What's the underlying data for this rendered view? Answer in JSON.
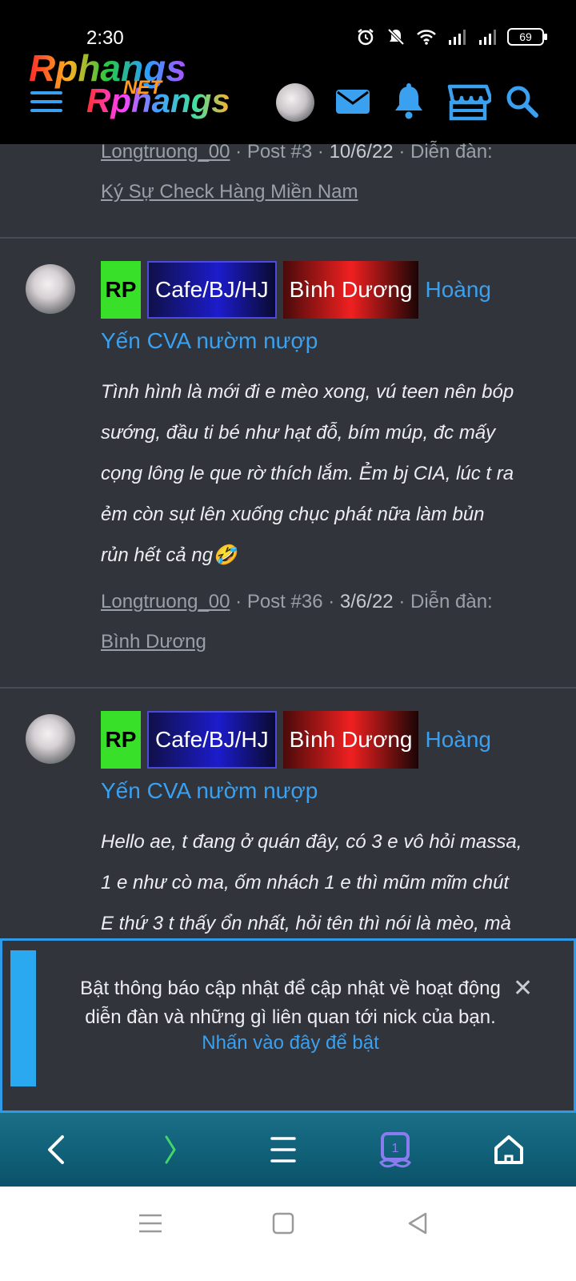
{
  "status_bar": {
    "time": "2:30",
    "battery": "69",
    "icons": [
      "alarm-icon",
      "mute-icon",
      "wifi-icon",
      "signal-icon",
      "signal-icon",
      "battery-icon"
    ]
  },
  "header": {
    "logo_top": "Rphangs",
    "logo_net": "NET",
    "logo_bottom": "Rphangs",
    "icons": [
      "menu-icon",
      "avatar",
      "mail-icon",
      "bell-icon",
      "store-icon",
      "search-icon"
    ],
    "accent": "#3aa0f0"
  },
  "posts": [
    {
      "author": "Longtruong_00",
      "post_no": "Post #3",
      "date": "10/6/22",
      "forum_label": "Diễn đàn:",
      "forum": "Ký Sự Check Hàng Miền Nam"
    },
    {
      "badges": [
        "RP",
        "Cafe/BJ/HJ",
        "Bình Dương"
      ],
      "title_part1": "Hoàng",
      "title_part2": "Yến CVA nườm nượp",
      "body_lines": [
        "Tình hình là mới đi e mèo xong, vú teen nên bóp",
        "sướng, đầu ti bé như hạt đỗ, bím múp, đc mấy",
        "cọng lông le que rờ thích lắm. Ẻm bj CIA, lúc t ra",
        "ẻm còn sụt lên xuống chục phát nữa làm bủn",
        "rủn hết cả ng🤣"
      ],
      "author": "Longtruong_00",
      "post_no": "Post #36",
      "date": "3/6/22",
      "forum_label": "Diễn đàn:",
      "forum": "Bình Dương"
    },
    {
      "badges": [
        "RP",
        "Cafe/BJ/HJ",
        "Bình Dương"
      ],
      "title_part1": "Hoàng",
      "title_part2": "Yến CVA nườm nượp",
      "body_lines": [
        "Hello ae, t đang ở quán đây, có 3 e vô hỏi massa,",
        "1 e như cò ma, ốm nhách 1 e thì mũm mĩm chút",
        "E thứ 3 t thấy ổn nhất, hỏi tên thì nói là mèo, mà"
      ]
    }
  ],
  "notification": {
    "line1": "Bật thông báo cập nhật để cập nhật về hoạt động",
    "line2": "diễn đàn và những gì liên quan tới nick của bạn.",
    "link": "Nhấn vào đây để bật",
    "close": "✕"
  },
  "browser_toolbar": {
    "tab_count": "1",
    "icons": [
      "back-icon",
      "forward-icon",
      "menu-icon",
      "tabs-icon",
      "home-icon"
    ]
  },
  "nav_bar": {
    "icons": [
      "recent-apps-icon",
      "home-icon",
      "back-icon"
    ]
  }
}
